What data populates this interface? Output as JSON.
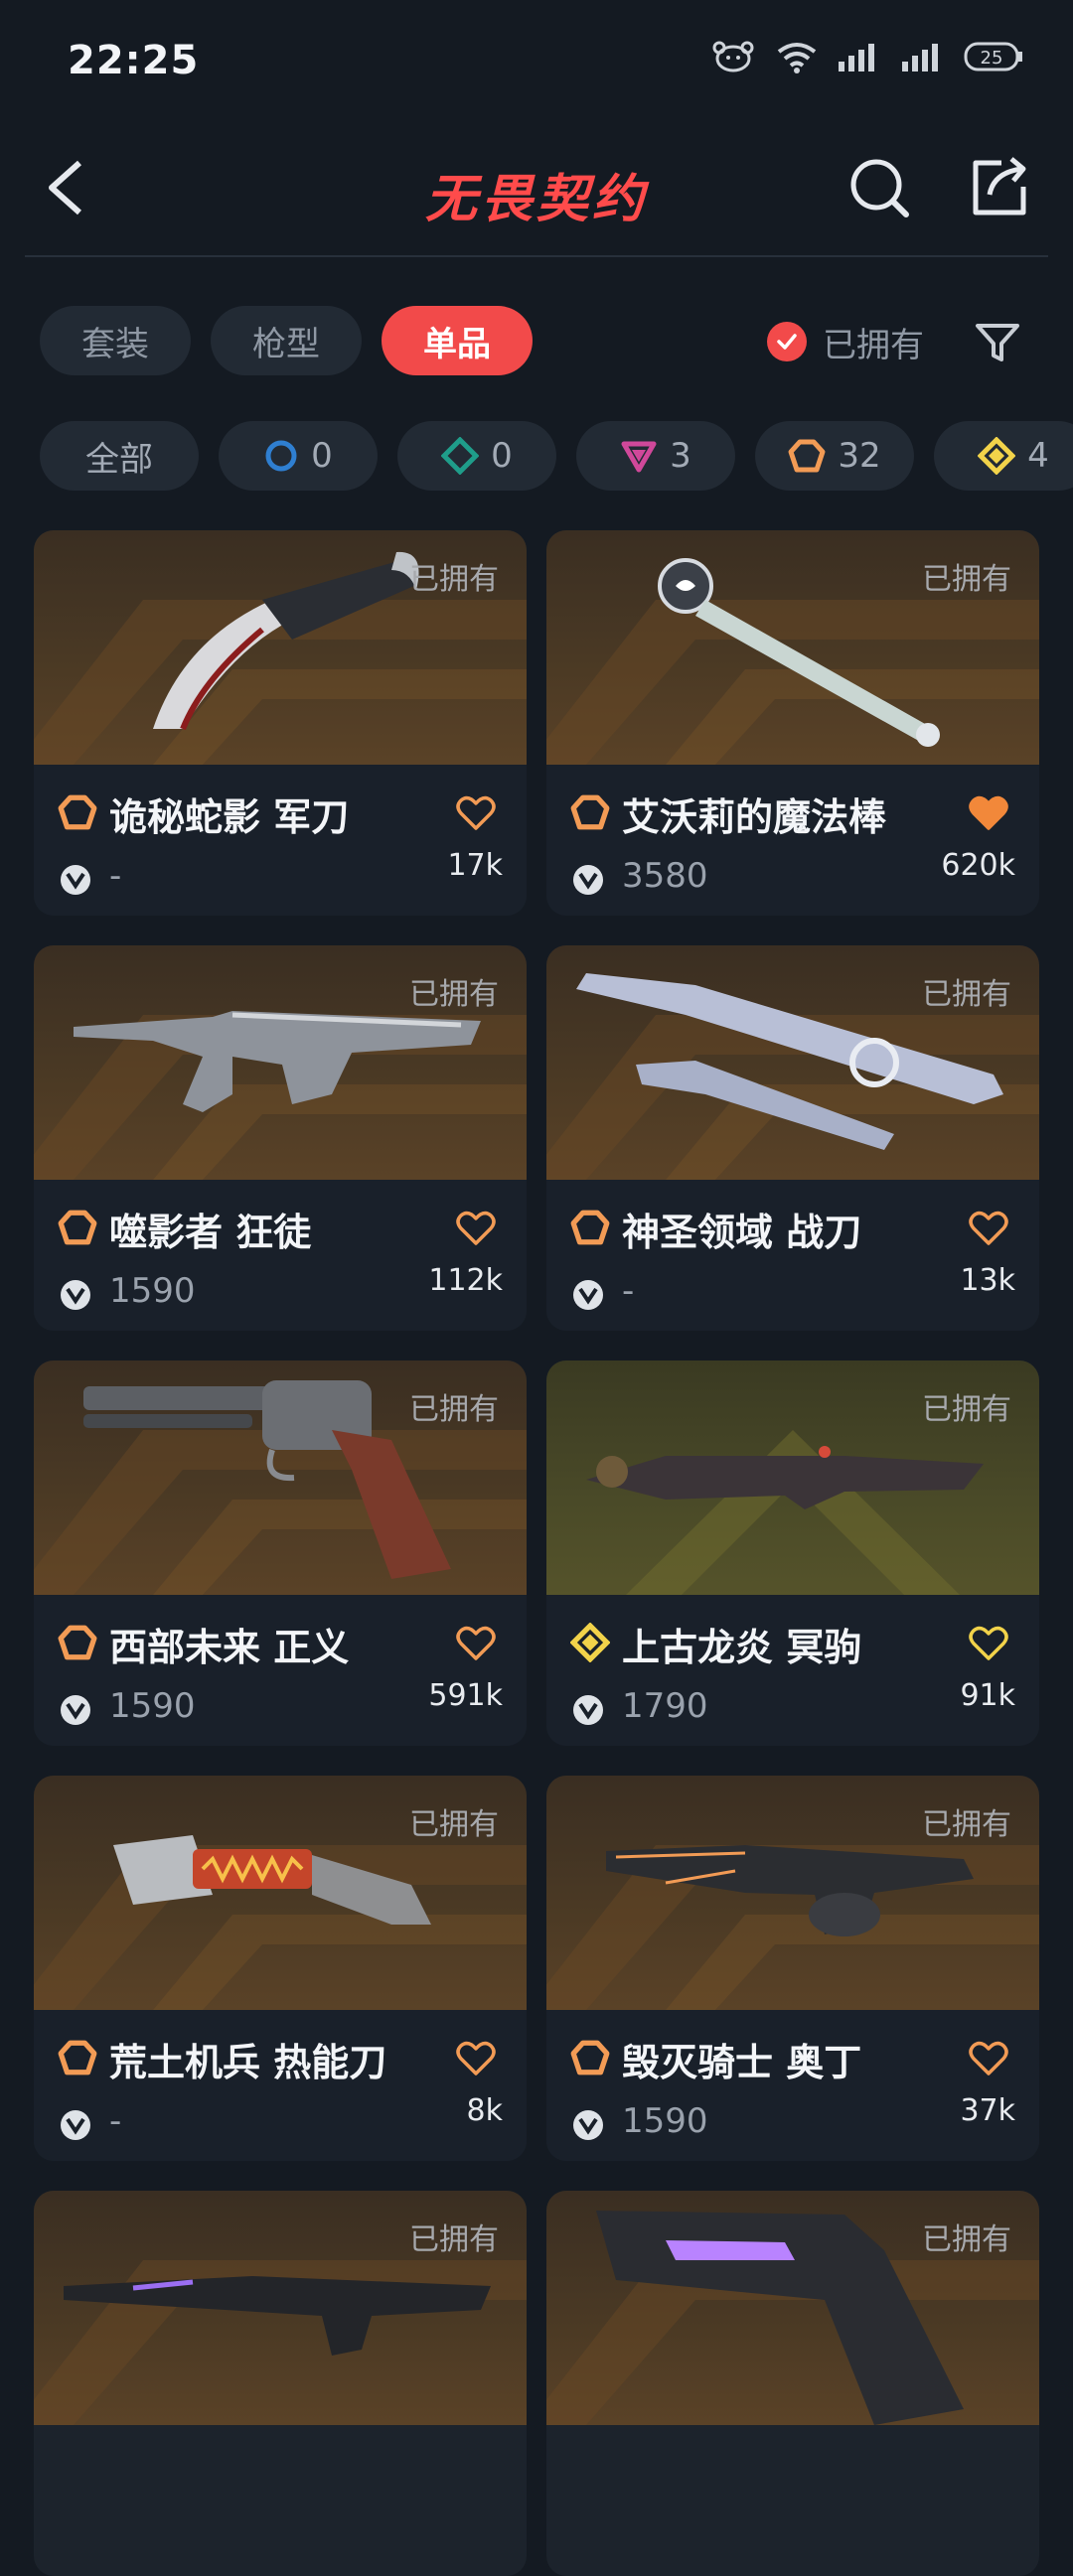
{
  "status_bar": {
    "time": "22:25",
    "battery": "25"
  },
  "header": {
    "title": "无畏契约"
  },
  "tabs": [
    {
      "label": "套装",
      "active": false
    },
    {
      "label": "枪型",
      "active": false
    },
    {
      "label": "单品",
      "active": true
    }
  ],
  "owned_filter": {
    "label": "已拥有",
    "checked": true
  },
  "rarity_filters": [
    {
      "label": "全部"
    },
    {
      "count": "0",
      "tier": "select",
      "color": "#2f7fd1"
    },
    {
      "count": "0",
      "tier": "deluxe",
      "color": "#1f9d8a"
    },
    {
      "count": "3",
      "tier": "premium",
      "color": "#d0489a"
    },
    {
      "count": "32",
      "tier": "exclusive",
      "color": "#f29b55"
    },
    {
      "count": "4",
      "tier": "ultra",
      "color": "#f2d34a"
    }
  ],
  "owned_badge": "已拥有",
  "items": [
    {
      "name": "诡秘蛇影 军刀",
      "price": "-",
      "likes": "17k",
      "tier": "exclusive",
      "liked": false
    },
    {
      "name": "艾沃莉的魔法棒",
      "price": "3580",
      "likes": "620k",
      "tier": "exclusive",
      "liked": true
    },
    {
      "name": "噬影者 狂徒",
      "price": "1590",
      "likes": "112k",
      "tier": "exclusive",
      "liked": false
    },
    {
      "name": "神圣领域 战刀",
      "price": "-",
      "likes": "13k",
      "tier": "exclusive",
      "liked": false
    },
    {
      "name": "西部未来 正义",
      "price": "1590",
      "likes": "591k",
      "tier": "exclusive",
      "liked": false
    },
    {
      "name": "上古龙炎 冥驹",
      "price": "1790",
      "likes": "91k",
      "tier": "ultra",
      "liked": false
    },
    {
      "name": "荒土机兵 热能刀",
      "price": "-",
      "likes": "8k",
      "tier": "exclusive",
      "liked": false
    },
    {
      "name": "毁灭骑士 奥丁",
      "price": "1590",
      "likes": "37k",
      "tier": "exclusive",
      "liked": false
    }
  ],
  "colors": {
    "accent": "#f24a4a",
    "exclusive": "#f29b55",
    "ultra": "#f2d34a",
    "liked": "#f2883a"
  }
}
